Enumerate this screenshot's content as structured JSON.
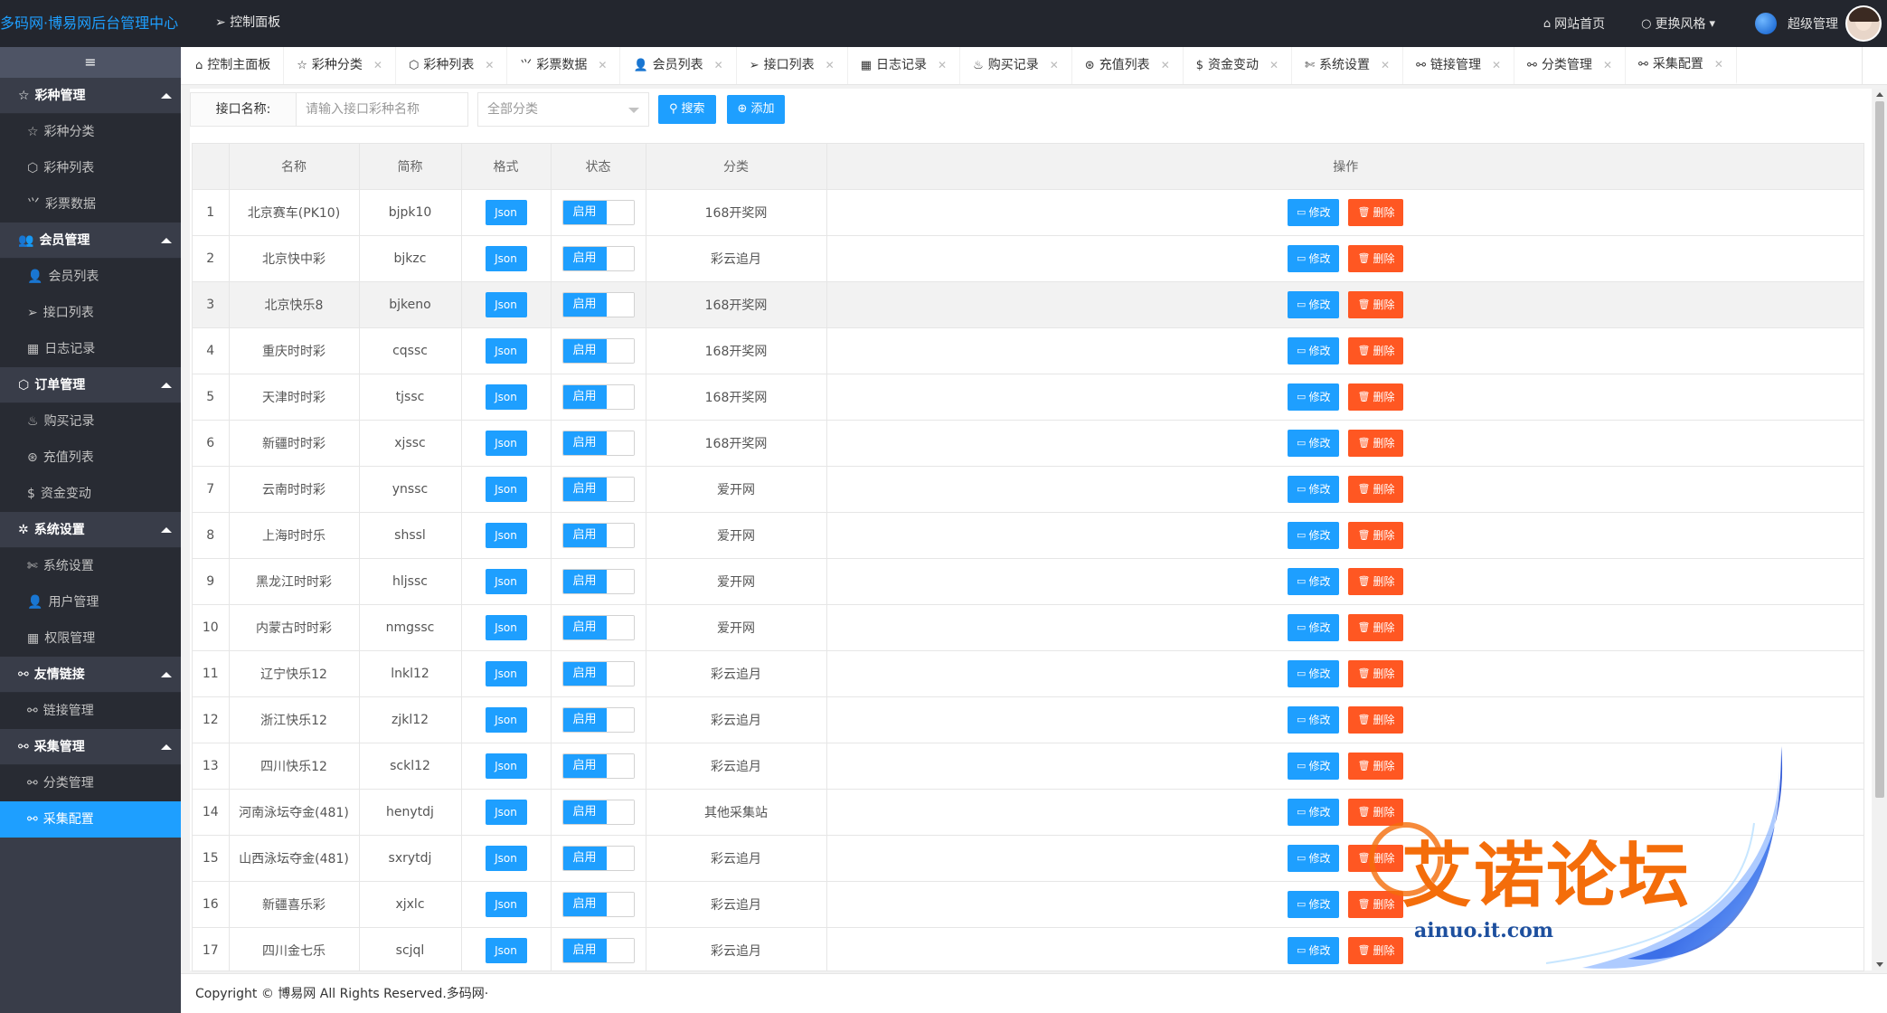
{
  "header": {
    "logo": "多码网·博易网后台管理中心",
    "control_panel": "控制面板",
    "site_home": "网站首页",
    "change_style": "更换风格",
    "admin_name": "超级管理"
  },
  "sidebar": {
    "toggle": "≡",
    "groups": [
      {
        "label": "彩种管理",
        "icon": "star-icon",
        "items": [
          {
            "label": "彩种分类",
            "icon": "star-icon"
          },
          {
            "label": "彩种列表",
            "icon": "cube-icon"
          },
          {
            "label": "彩票数据",
            "icon": "chart-icon"
          }
        ]
      },
      {
        "label": "会员管理",
        "icon": "users-icon",
        "items": [
          {
            "label": "会员列表",
            "icon": "user-icon"
          },
          {
            "label": "接口列表",
            "icon": "send-icon"
          },
          {
            "label": "日志记录",
            "icon": "calendar-icon"
          }
        ]
      },
      {
        "label": "订单管理",
        "icon": "cube-icon",
        "items": [
          {
            "label": "购买记录",
            "icon": "fire-icon"
          },
          {
            "label": "充值列表",
            "icon": "compass-icon"
          },
          {
            "label": "资金变动",
            "icon": "dollar-icon"
          }
        ]
      },
      {
        "label": "系统设置",
        "icon": "gear-icon",
        "items": [
          {
            "label": "系统设置",
            "icon": "tools-icon"
          },
          {
            "label": "用户管理",
            "icon": "user-icon"
          },
          {
            "label": "权限管理",
            "icon": "calendar-icon"
          }
        ]
      },
      {
        "label": "友情链接",
        "icon": "link-icon",
        "items": [
          {
            "label": "链接管理",
            "icon": "link-icon"
          }
        ]
      },
      {
        "label": "采集管理",
        "icon": "link-icon",
        "items": [
          {
            "label": "分类管理",
            "icon": "link-icon"
          },
          {
            "label": "采集配置",
            "icon": "link-icon",
            "active": true
          }
        ]
      }
    ]
  },
  "tabs": [
    {
      "label": "控制主面板",
      "icon": "home-icon",
      "closable": false
    },
    {
      "label": "彩种分类",
      "icon": "star-icon",
      "closable": true
    },
    {
      "label": "彩种列表",
      "icon": "cube-icon",
      "closable": true
    },
    {
      "label": "彩票数据",
      "icon": "chart-icon",
      "closable": true
    },
    {
      "label": "会员列表",
      "icon": "user-icon",
      "closable": true
    },
    {
      "label": "接口列表",
      "icon": "send-icon",
      "closable": true
    },
    {
      "label": "日志记录",
      "icon": "calendar-icon",
      "closable": true
    },
    {
      "label": "购买记录",
      "icon": "fire-icon",
      "closable": true
    },
    {
      "label": "充值列表",
      "icon": "compass-icon",
      "closable": true
    },
    {
      "label": "资金变动",
      "icon": "dollar-icon",
      "closable": true
    },
    {
      "label": "系统设置",
      "icon": "tools-icon",
      "closable": true
    },
    {
      "label": "链接管理",
      "icon": "link-icon",
      "closable": true
    },
    {
      "label": "分类管理",
      "icon": "link-icon",
      "closable": true
    },
    {
      "label": "采集配置",
      "icon": "link-icon",
      "closable": true,
      "active": true
    }
  ],
  "filter": {
    "label": "接口名称:",
    "placeholder": "请输入接口彩种名称",
    "select_value": "全部分类",
    "search_label": "搜索",
    "add_label": "添加"
  },
  "table": {
    "headers": [
      "",
      "名称",
      "简称",
      "格式",
      "状态",
      "分类",
      "操作"
    ],
    "edit_label": "修改",
    "delete_label": "删除",
    "rows": [
      {
        "id": "1",
        "name": "北京赛车(PK10)",
        "code": "bjpk10",
        "format": "Json",
        "status": "启用",
        "category": "168开奖网"
      },
      {
        "id": "2",
        "name": "北京快中彩",
        "code": "bjkzc",
        "format": "Json",
        "status": "启用",
        "category": "彩云追月"
      },
      {
        "id": "3",
        "name": "北京快乐8",
        "code": "bjkeno",
        "format": "Json",
        "status": "启用",
        "category": "168开奖网",
        "highlight": true
      },
      {
        "id": "4",
        "name": "重庆时时彩",
        "code": "cqssc",
        "format": "Json",
        "status": "启用",
        "category": "168开奖网"
      },
      {
        "id": "5",
        "name": "天津时时彩",
        "code": "tjssc",
        "format": "Json",
        "status": "启用",
        "category": "168开奖网"
      },
      {
        "id": "6",
        "name": "新疆时时彩",
        "code": "xjssc",
        "format": "Json",
        "status": "启用",
        "category": "168开奖网"
      },
      {
        "id": "7",
        "name": "云南时时彩",
        "code": "ynssc",
        "format": "Json",
        "status": "启用",
        "category": "爱开网"
      },
      {
        "id": "8",
        "name": "上海时时乐",
        "code": "shssl",
        "format": "Json",
        "status": "启用",
        "category": "爱开网"
      },
      {
        "id": "9",
        "name": "黑龙江时时彩",
        "code": "hljssc",
        "format": "Json",
        "status": "启用",
        "category": "爱开网"
      },
      {
        "id": "10",
        "name": "内蒙古时时彩",
        "code": "nmgssc",
        "format": "Json",
        "status": "启用",
        "category": "爱开网"
      },
      {
        "id": "11",
        "name": "辽宁快乐12",
        "code": "lnkl12",
        "format": "Json",
        "status": "启用",
        "category": "彩云追月"
      },
      {
        "id": "12",
        "name": "浙江快乐12",
        "code": "zjkl12",
        "format": "Json",
        "status": "启用",
        "category": "彩云追月"
      },
      {
        "id": "13",
        "name": "四川快乐12",
        "code": "sckl12",
        "format": "Json",
        "status": "启用",
        "category": "彩云追月"
      },
      {
        "id": "14",
        "name": "河南泳坛夺金(481)",
        "code": "henytdj",
        "format": "Json",
        "status": "启用",
        "category": "其他采集站"
      },
      {
        "id": "15",
        "name": "山西泳坛夺金(481)",
        "code": "sxrytdj",
        "format": "Json",
        "status": "启用",
        "category": "彩云追月"
      },
      {
        "id": "16",
        "name": "新疆喜乐彩",
        "code": "xjxlc",
        "format": "Json",
        "status": "启用",
        "category": "彩云追月"
      },
      {
        "id": "17",
        "name": "四川金七乐",
        "code": "scjql",
        "format": "Json",
        "status": "启用",
        "category": "彩云追月"
      }
    ]
  },
  "footer": {
    "text": "Copyright © 博易网 All Rights Reserved.多码网·"
  },
  "watermark": {
    "text": "艾诺论坛",
    "url": "ainuo.it.com"
  },
  "colors": {
    "primary": "#1e9fff",
    "danger": "#ff5722",
    "sidebar": "#393d49",
    "header": "#23262e"
  }
}
